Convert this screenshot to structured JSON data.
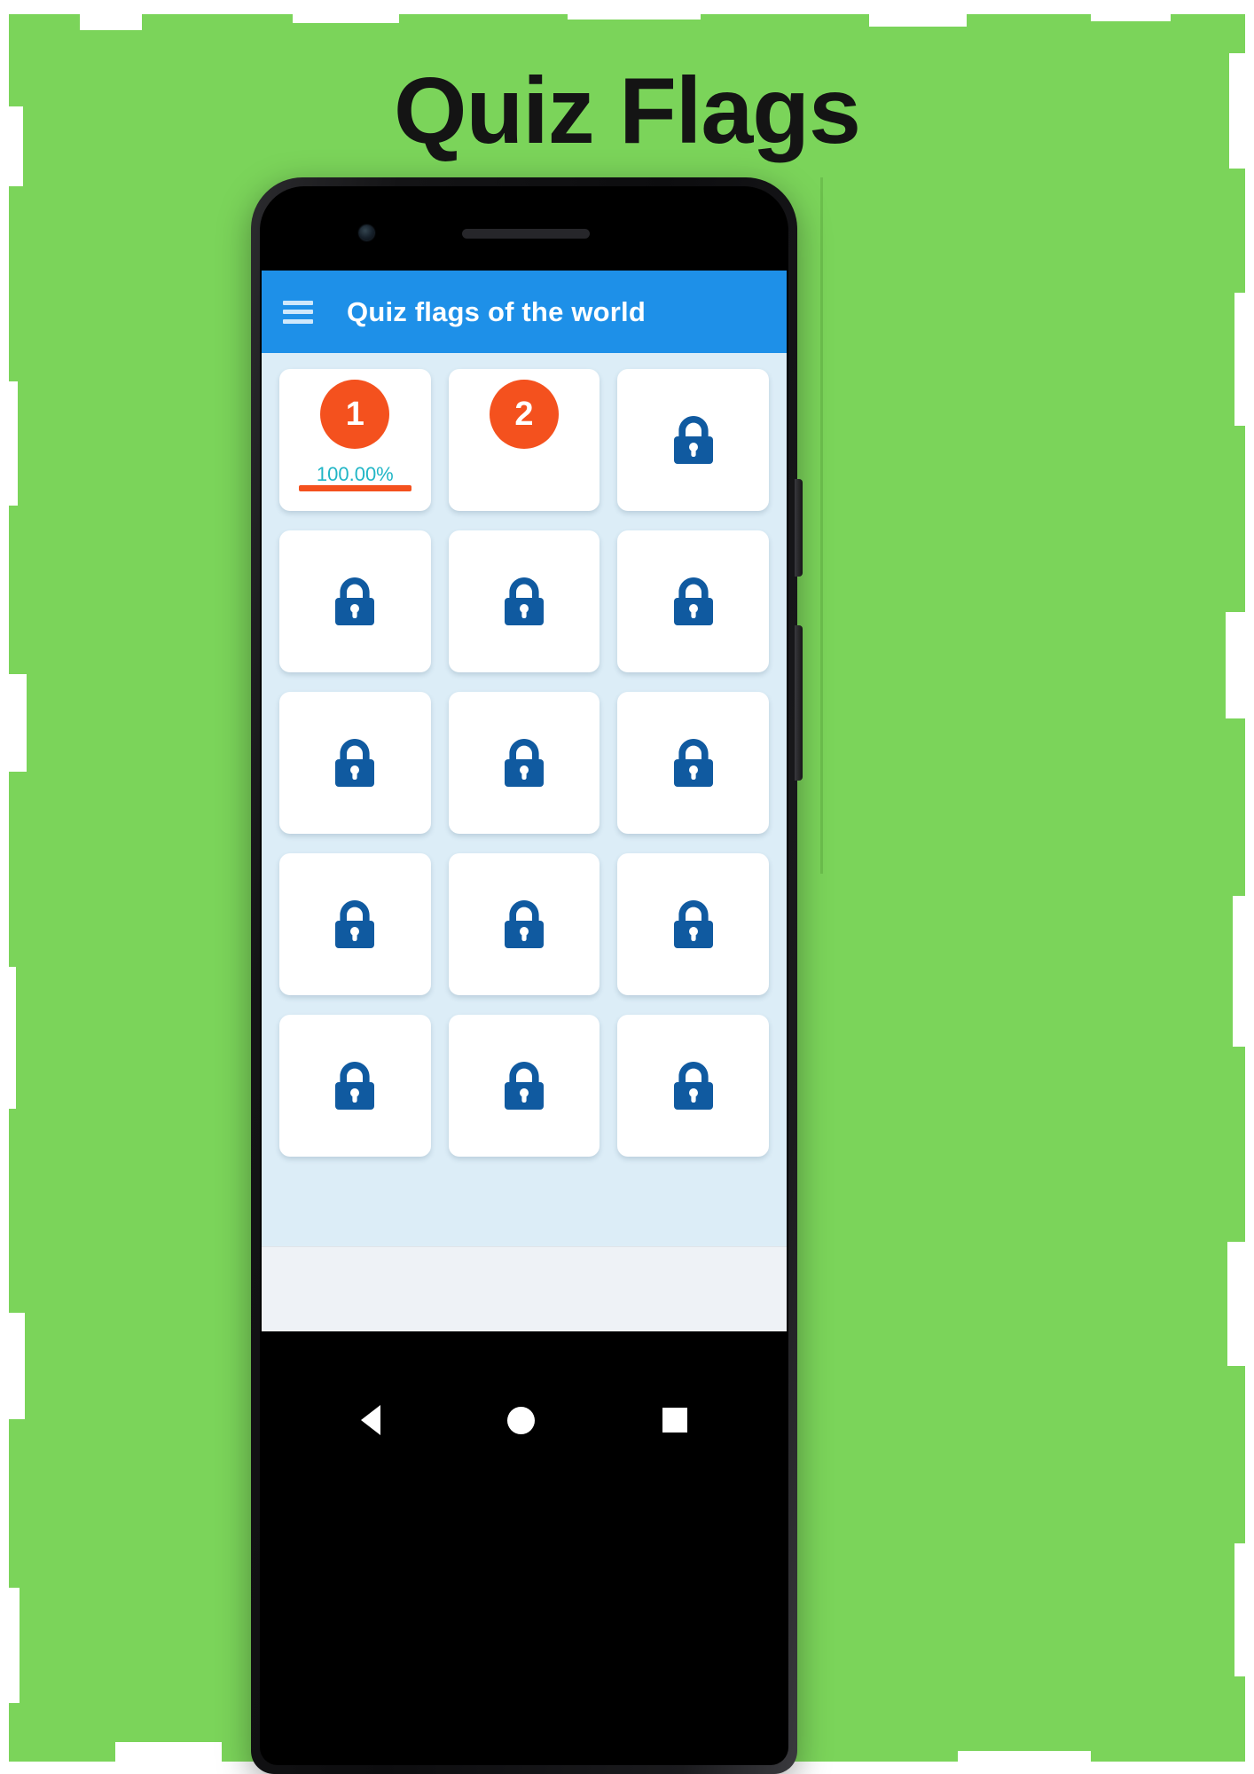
{
  "poster": {
    "title": "Quiz Flags",
    "background_color": "#7BD45A",
    "title_color": "#141414"
  },
  "phone": {
    "camera_icon": "camera-dot",
    "speaker_icon": "speaker-grille"
  },
  "app": {
    "appbar": {
      "menu_icon": "hamburger-menu-icon",
      "title": "Quiz flags of the world",
      "background_color": "#1E90E8",
      "title_color": "#FFFFFF"
    },
    "screen_background_color": "#DCEDF7",
    "accent_color": "#F4511E",
    "percent_color": "#21B6C6",
    "lock_color": "#105AA0",
    "levels": [
      {
        "number": "1",
        "state": "completed",
        "percent": "100.00%",
        "progress": 100,
        "lock_icon": null
      },
      {
        "number": "2",
        "state": "unlocked",
        "percent": null,
        "progress": 0,
        "lock_icon": null
      },
      {
        "number": null,
        "state": "locked",
        "percent": null,
        "progress": 0,
        "lock_icon": "lock-icon"
      },
      {
        "number": null,
        "state": "locked",
        "percent": null,
        "progress": 0,
        "lock_icon": "lock-icon"
      },
      {
        "number": null,
        "state": "locked",
        "percent": null,
        "progress": 0,
        "lock_icon": "lock-icon"
      },
      {
        "number": null,
        "state": "locked",
        "percent": null,
        "progress": 0,
        "lock_icon": "lock-icon"
      },
      {
        "number": null,
        "state": "locked",
        "percent": null,
        "progress": 0,
        "lock_icon": "lock-icon"
      },
      {
        "number": null,
        "state": "locked",
        "percent": null,
        "progress": 0,
        "lock_icon": "lock-icon"
      },
      {
        "number": null,
        "state": "locked",
        "percent": null,
        "progress": 0,
        "lock_icon": "lock-icon"
      },
      {
        "number": null,
        "state": "locked",
        "percent": null,
        "progress": 0,
        "lock_icon": "lock-icon"
      },
      {
        "number": null,
        "state": "locked",
        "percent": null,
        "progress": 0,
        "lock_icon": "lock-icon"
      },
      {
        "number": null,
        "state": "locked",
        "percent": null,
        "progress": 0,
        "lock_icon": "lock-icon"
      },
      {
        "number": null,
        "state": "locked",
        "percent": null,
        "progress": 0,
        "lock_icon": "lock-icon"
      },
      {
        "number": null,
        "state": "locked",
        "percent": null,
        "progress": 0,
        "lock_icon": "lock-icon"
      },
      {
        "number": null,
        "state": "locked",
        "percent": null,
        "progress": 0,
        "lock_icon": "lock-icon"
      }
    ]
  },
  "navbar": {
    "back_icon": "triangle-back-icon",
    "home_icon": "circle-home-icon",
    "recents_icon": "square-recents-icon"
  }
}
